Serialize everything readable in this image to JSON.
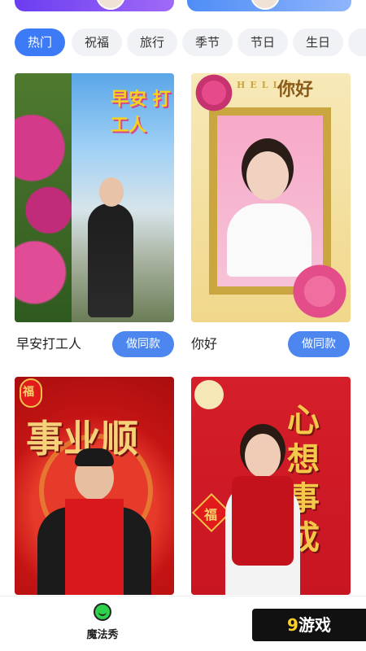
{
  "tabs": [
    {
      "label": "热门",
      "active": true
    },
    {
      "label": "祝福",
      "active": false
    },
    {
      "label": "旅行",
      "active": false
    },
    {
      "label": "季节",
      "active": false
    },
    {
      "label": "节日",
      "active": false
    },
    {
      "label": "生日",
      "active": false
    }
  ],
  "cards": [
    {
      "title": "早安打工人",
      "overlay": "早安 打工人",
      "button": "做同款"
    },
    {
      "title": "你好",
      "overlay": "你好",
      "frame_text": "HELLO",
      "button": "做同款"
    },
    {
      "title": "",
      "overlay": "事业顺",
      "fu": "福"
    },
    {
      "title": "",
      "overlay": "心想事成",
      "fu": "福"
    }
  ],
  "bottom_nav": {
    "label": "魔法秀",
    "icon": "smile-icon"
  },
  "watermark": {
    "num": "9",
    "text": "游戏"
  },
  "colors": {
    "accent": "#3d7af5",
    "button": "#4c86ee",
    "festive_red": "#d81e1e"
  }
}
